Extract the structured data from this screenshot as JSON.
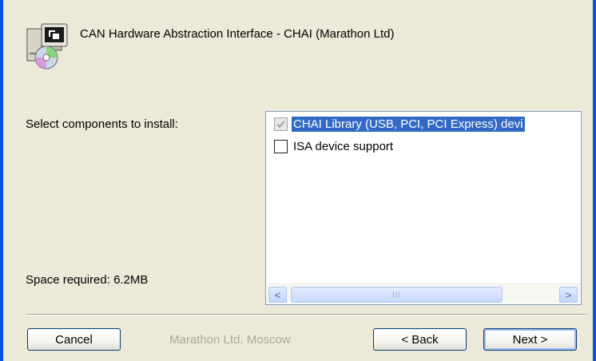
{
  "header": {
    "title": "CAN Hardware Abstraction Interface - CHAI (Marathon Ltd)",
    "icon": "installer-computer-cd-icon"
  },
  "main": {
    "select_label": "Select components to install:",
    "space_required": "Space required: 6.2MB",
    "components": [
      {
        "label": "CHAI Library (USB, PCI, PCI Express) devi",
        "checked": true,
        "disabled": true,
        "selected": true
      },
      {
        "label": "ISA device support",
        "checked": false,
        "disabled": false,
        "selected": false
      }
    ],
    "scrollbar": {
      "left_arrow": "<",
      "right_arrow": ">",
      "thumb_grip": "III"
    }
  },
  "footer": {
    "brand": "Marathon Ltd. Moscow",
    "cancel_label": "Cancel",
    "back_label": "< Back",
    "next_label": "Next >"
  },
  "colors": {
    "dialog_bg": "#ECE9D8",
    "frame": "#0054E3",
    "selection": "#316AC5",
    "disabled_text": "#ACA899"
  }
}
